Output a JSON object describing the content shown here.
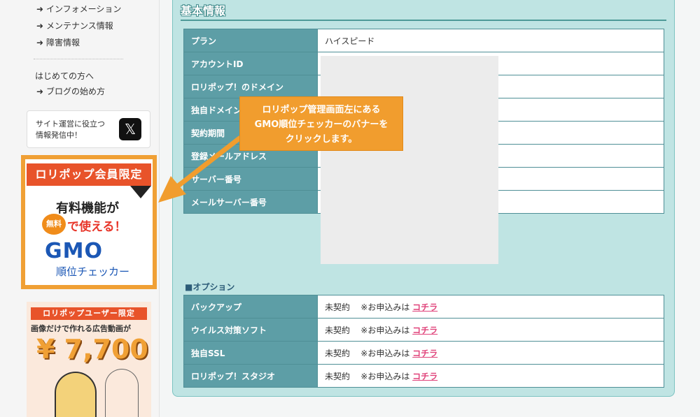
{
  "sidebar": {
    "links_top": [
      "インフォメーション",
      "メンテナンス情報",
      "障害情報"
    ],
    "heading": "はじめての方へ",
    "link_blog": "ブログの始め方",
    "x_box": {
      "line1": "サイト運営に役立つ",
      "line2": "情報発信中！",
      "icon": "x-logo-icon"
    },
    "gmo_banner": {
      "top_label": "ロリポップ会員限定",
      "line1": "有料機能が",
      "pumpkin_text": "無料",
      "line2": "で使える！",
      "brand": "GMO",
      "sub": "順位チェッカー"
    },
    "ad2": {
      "top_label": "ロリポップユーザー限定",
      "sub": "画像だけで作れる広告動画が",
      "price": "¥ 7,700"
    }
  },
  "main": {
    "title": "基本情報",
    "basic_rows": [
      {
        "label": "プラン",
        "value": "ハイスピード"
      },
      {
        "label": "アカウントID",
        "value": ""
      },
      {
        "label": "ロリポップ！のドメイン",
        "value": ""
      },
      {
        "label": "独自ドメイン",
        "value": ""
      },
      {
        "label": "契約期間",
        "value": ""
      },
      {
        "label": "登録メールアドレス",
        "value": ""
      },
      {
        "label": "サーバー番号",
        "value": ""
      },
      {
        "label": "メールサーバー番号",
        "value": ""
      }
    ],
    "option_label": "■オプション",
    "option_rows": [
      {
        "label": "バックアップ",
        "status": "未契約",
        "note": "※お申込みは",
        "link": "コチラ"
      },
      {
        "label": "ウイルス対策ソフト",
        "status": "未契約",
        "note": "※お申込みは",
        "link": "コチラ"
      },
      {
        "label": "独自SSL",
        "status": "未契約",
        "note": "※お申込みは",
        "link": "コチラ"
      },
      {
        "label": "ロリポップ！スタジオ",
        "status": "未契約",
        "note": "※お申込みは",
        "link": "コチラ"
      }
    ]
  },
  "annotation": {
    "line1": "ロリポップ管理画面左にある",
    "line2": "GMO順位チェッカーのバナーを",
    "line3": "クリックします。"
  },
  "colors": {
    "panel_bg": "#bfe4e3",
    "label_bg": "#5d9ea6",
    "annotation": "#f19d2e",
    "link": "#e0447b"
  }
}
